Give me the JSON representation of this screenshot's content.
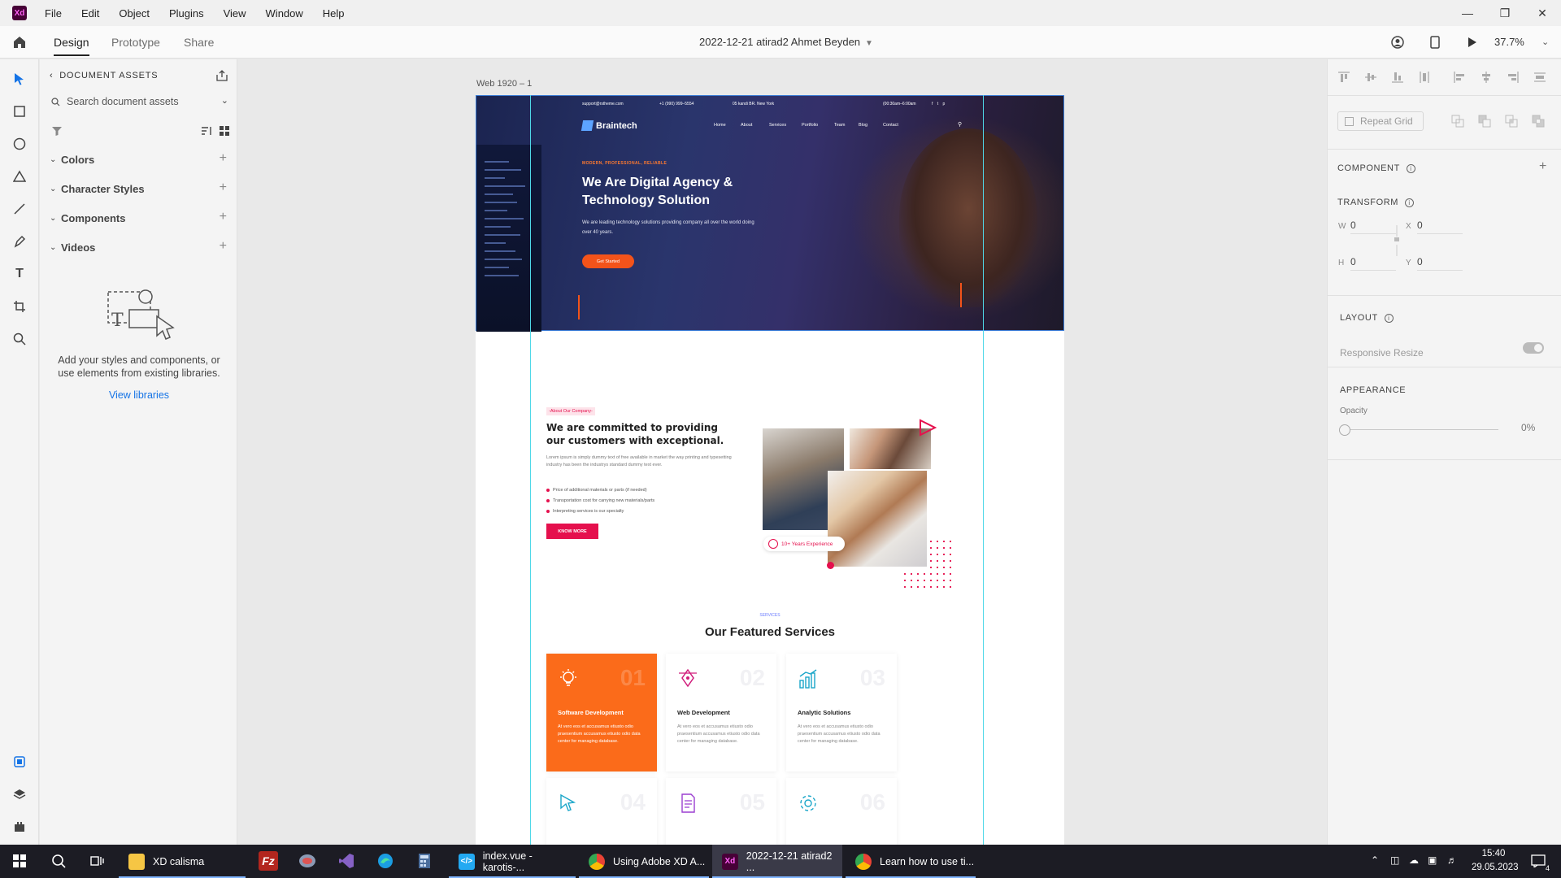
{
  "app": {
    "logo": "Xd",
    "menu": [
      "File",
      "Edit",
      "Object",
      "Plugins",
      "View",
      "Window",
      "Help"
    ],
    "window_controls": [
      "minimize",
      "restore",
      "close"
    ]
  },
  "toolbar": {
    "tabs": [
      "Design",
      "Prototype",
      "Share"
    ],
    "active_tab": "Design",
    "document_title": "2022-12-21 atirad2 Ahmet Beyden",
    "zoom": "37.7%"
  },
  "assets_panel": {
    "heading": "DOCUMENT ASSETS",
    "search_placeholder": "Search document assets",
    "sections": [
      "Colors",
      "Character Styles",
      "Components",
      "Videos"
    ],
    "empty_text": "Add your styles and components, or use elements from existing libraries.",
    "view_libraries": "View libraries"
  },
  "artboard": {
    "label": "Web 1920 – 1",
    "hero": {
      "email": "support@rstheme.com",
      "phone": "+1 (990) 999–5554",
      "address": "05 kandi BR. New York",
      "hours": "(00:30am–6:00am",
      "brand": "Braintech",
      "nav": [
        "Home",
        "About",
        "Services",
        "Portfolio",
        "Team",
        "Blog",
        "Contact"
      ],
      "eyebrow": "MODERN, PROFESSIONAL, RELIABLE",
      "title": "We Are Digital Agency & Technology Solution",
      "subtitle": "We are leading technology solutions providing company all over the world doing over 40 years.",
      "cta": "Get Started"
    },
    "about": {
      "tag": "About Our Company",
      "title": "We are committed to providing our customers with exceptional.",
      "body": "Lorem ipsum is simply dummy text of free available in market the way printing and typesetting industry has been the industrys standard dummy text ever.",
      "bullets": [
        "Price of additional materials or parts (if needed)",
        "Transportation cost for carrying new materials/parts",
        "Interpreting services is our specialty"
      ],
      "button": "KNOW MORE",
      "experience_badge": "10+ Years Experience"
    },
    "services": {
      "eyebrow": "SERVICES",
      "title": "Our Featured Services",
      "cards": [
        {
          "num": "01",
          "title": "Software Development",
          "body": "At vero eos et accusamus etiusto odio praesentium accusamus etiusto odio data center for managing database.",
          "icon": "lightbulb-icon"
        },
        {
          "num": "02",
          "title": "Web Development",
          "body": "At vero eos et accusamus etiusto odio praesentium accusamus etiusto odio data center for managing database.",
          "icon": "pen-tool-icon"
        },
        {
          "num": "03",
          "title": "Analytic Solutions",
          "body": "At vero eos et accusamus etiusto odio praesentium accusamus etiusto odio data center for managing database.",
          "icon": "bar-chart-icon"
        }
      ],
      "cards_row2": [
        "04",
        "05",
        "06"
      ]
    }
  },
  "properties": {
    "repeat_grid": "Repeat Grid",
    "component": "COMPONENT",
    "transform": "TRANSFORM",
    "w_label": "W",
    "w": "0",
    "x_label": "X",
    "x": "0",
    "h_label": "H",
    "h": "0",
    "y_label": "Y",
    "y": "0",
    "layout": "LAYOUT",
    "responsive_resize": "Responsive Resize",
    "appearance": "APPEARANCE",
    "opacity_label": "Opacity",
    "opacity": "0%"
  },
  "taskbar": {
    "apps": [
      {
        "label": "XD calisma",
        "icon": "folder-icon"
      },
      {
        "label": "index.vue - karotis-...",
        "icon": "vscode-icon"
      },
      {
        "label": "Using Adobe XD A...",
        "icon": "chrome-icon"
      },
      {
        "label": "2022-12-21 atirad2 ...",
        "icon": "xd-icon"
      },
      {
        "label": "Learn how to use ti...",
        "icon": "chrome-icon"
      }
    ],
    "time": "15:40",
    "date": "29.05.2023",
    "notifications": "4"
  }
}
